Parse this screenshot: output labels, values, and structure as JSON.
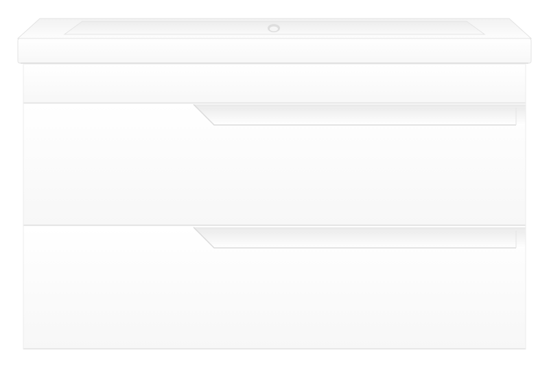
{
  "product": {
    "kind": "wall-hung vanity unit with integrated sink",
    "finish": "gloss white",
    "drawer_count": 2
  },
  "colors": {
    "background": "#ffffff",
    "body_white": "#fbfbfb",
    "edge_shadow": "#e6e6e6",
    "soft_shadow": "#dcdcdc",
    "basin_inner": "#f4f4f4"
  },
  "icons": {
    "faucet_hole": "tap-hole-icon",
    "drawer_pull": "handle-groove-icon"
  }
}
